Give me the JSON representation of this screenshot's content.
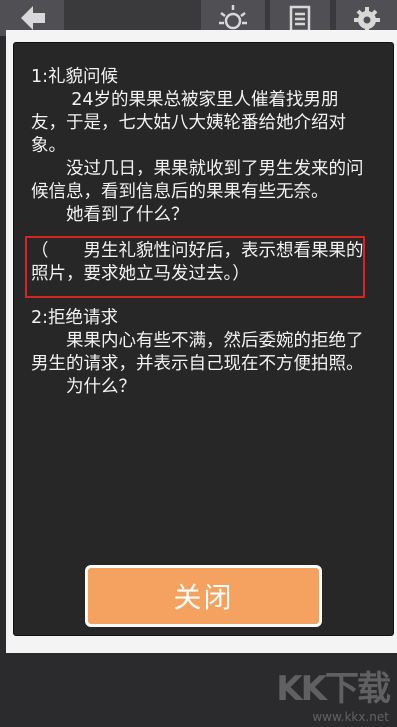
{
  "top_bar": {
    "icons": [
      "back-arrow-icon",
      "sun-icon",
      "list-icon",
      "gear-icon"
    ]
  },
  "content": {
    "section1_title": "1:礼貌问候",
    "para1": "24岁的果果总被家里人催着找男朋友，于是，七大姑八大姨轮番给她介绍对象。",
    "para2": "没过几日，果果就收到了男生发来的问候信息，看到信息后的果果有些无奈。",
    "question1": "她看到了什么？",
    "answer1": "（　　男生礼貌性问好后，表示想看果果的照片，要求她立马发过去。）",
    "section2_title": "2:拒绝请求",
    "para3": "果果内心有些不满，然后委婉的拒绝了男生的请求，并表示自己现在不方便拍照。",
    "question2": "为什么？"
  },
  "close_button": {
    "label": "关闭"
  },
  "watermark": {
    "logo": "KK下载",
    "url": "www.kkx.net"
  },
  "colors": {
    "panel_bg": "#272727",
    "highlight_border": "#d42424",
    "button_bg": "#f5a15f"
  }
}
